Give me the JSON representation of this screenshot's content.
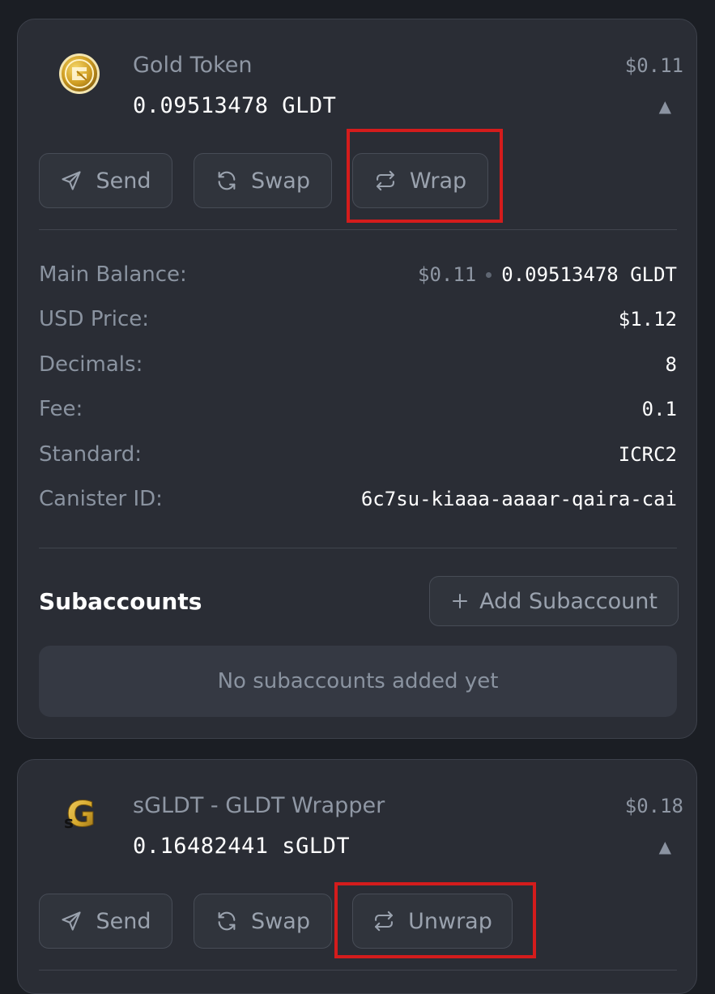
{
  "tokens": [
    {
      "name": "Gold Token",
      "balance": "0.09513478 GLDT",
      "usd": "$0.11",
      "collapse_glyph": "▲",
      "actions": {
        "send": "Send",
        "swap": "Swap",
        "wrap": "Wrap"
      },
      "details": {
        "main_balance_label": "Main Balance:",
        "main_balance_usd": "$0.11",
        "main_balance_amount": "0.09513478 GLDT",
        "usd_price_label": "USD Price:",
        "usd_price": "$1.12",
        "decimals_label": "Decimals:",
        "decimals": "8",
        "fee_label": "Fee:",
        "fee": "0.1",
        "standard_label": "Standard:",
        "standard": "ICRC2",
        "canister_label": "Canister ID:",
        "canister": "6c7su-kiaaa-aaaar-qaira-cai"
      },
      "subaccounts": {
        "title": "Subaccounts",
        "add_button": "Add Subaccount",
        "empty_text": "No subaccounts added yet"
      }
    },
    {
      "name": "sGLDT - GLDT Wrapper",
      "balance": "0.16482441 sGLDT",
      "usd": "$0.18",
      "collapse_glyph": "▲",
      "actions": {
        "send": "Send",
        "swap": "Swap",
        "unwrap": "Unwrap"
      }
    }
  ],
  "icons": {
    "gold_logo": "gold-token-logo",
    "sgldt_logo": "sgldt-logo",
    "send": "paper-plane-icon",
    "swap": "refresh-icon",
    "wrap": "arrows-exchange-icon",
    "add": "plus-icon"
  },
  "colors": {
    "page_bg": "#1b1e24",
    "card_bg": "#2a2d35",
    "highlight": "#d41c1c",
    "gold": "#d4a62a"
  }
}
